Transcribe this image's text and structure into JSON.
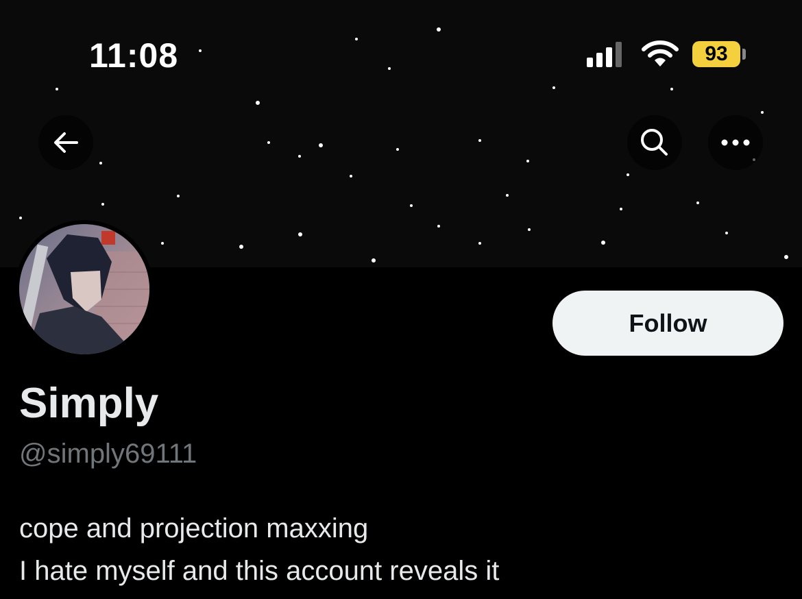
{
  "status_bar": {
    "time": "11:08",
    "battery": "93"
  },
  "nav": {
    "back_icon": "arrow-left-icon",
    "search_icon": "search-icon",
    "more_icon": "ellipsis-icon"
  },
  "profile": {
    "display_name": "Simply",
    "handle": "@simply69111",
    "bio_lines": [
      "cope and projection maxxing",
      "I hate myself and this account reveals it"
    ],
    "follow_label": "Follow"
  },
  "colors": {
    "background": "#000000",
    "follow_bg": "#eff3f4",
    "handle": "#71767b",
    "battery": "#f4d03f"
  }
}
